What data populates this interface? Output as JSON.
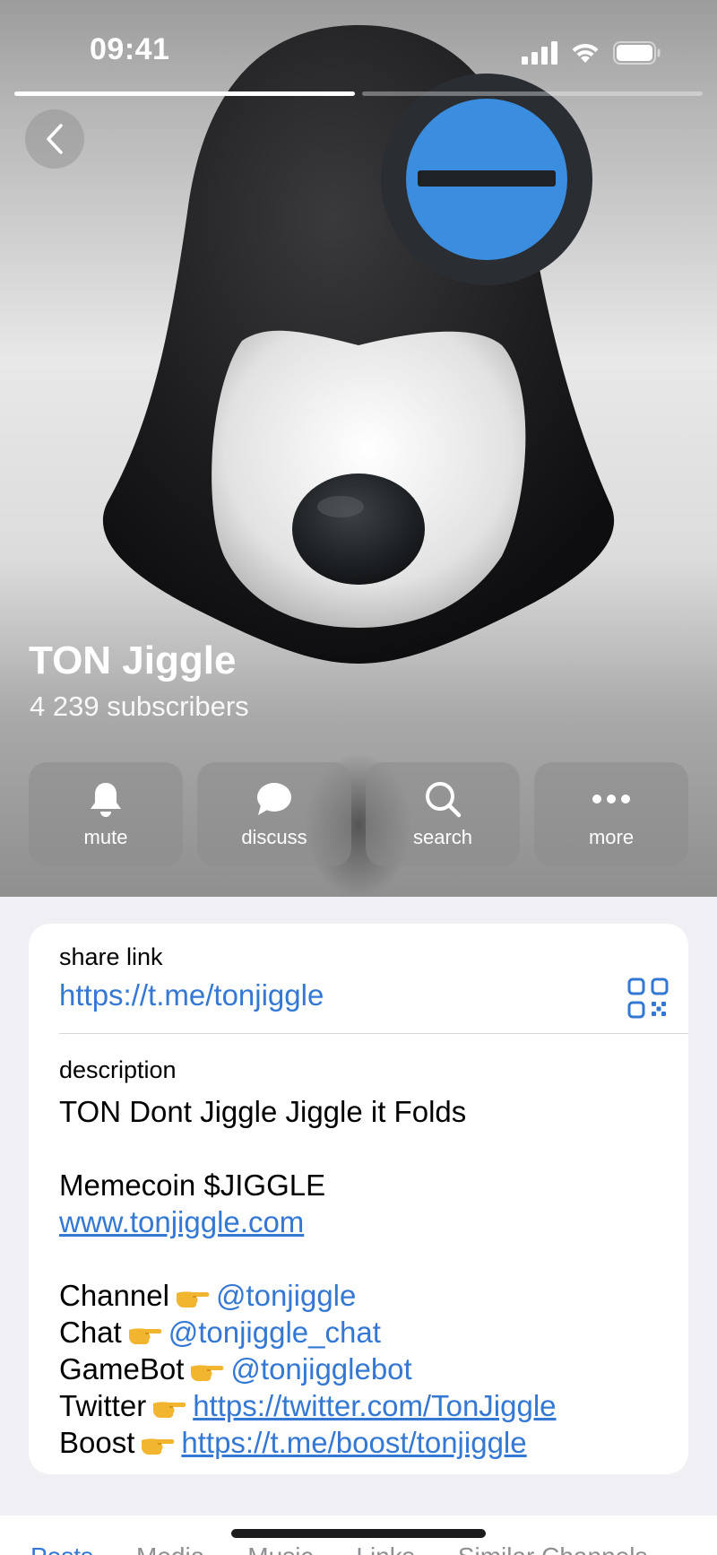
{
  "status_bar": {
    "time": "09:41"
  },
  "channel": {
    "title": "TON Jiggle",
    "subscribers": "4 239 subscribers"
  },
  "actions": [
    {
      "label": "mute",
      "icon": "bell-icon"
    },
    {
      "label": "discuss",
      "icon": "chat-bubble-icon"
    },
    {
      "label": "search",
      "icon": "magnifier-icon"
    },
    {
      "label": "more",
      "icon": "ellipsis-icon"
    }
  ],
  "share": {
    "label": "share link",
    "url": "https://t.me/tonjiggle"
  },
  "description": {
    "label": "description",
    "line1": "TON Dont Jiggle Jiggle it Folds",
    "line2": "Memecoin $JIGGLE",
    "website": "www.tonjiggle.com",
    "rows": [
      {
        "prefix": "Channel",
        "link": "@tonjiggle"
      },
      {
        "prefix": "Chat",
        "link": "@tonjiggle_chat"
      },
      {
        "prefix": "GameBot",
        "link": "@tonjigglebot"
      },
      {
        "prefix": "Twitter",
        "link": "https://twitter.com/TonJiggle"
      },
      {
        "prefix": "Boost",
        "link": "https://t.me/boost/tonjiggle"
      }
    ]
  },
  "tabs": [
    "Posts",
    "Media",
    "Music",
    "Links",
    "Similar Channels"
  ],
  "colors": {
    "accent": "#3478d4",
    "badge_blue": "#3b8de0",
    "card_bg": "#ffffff",
    "page_bg": "#efeff4"
  }
}
